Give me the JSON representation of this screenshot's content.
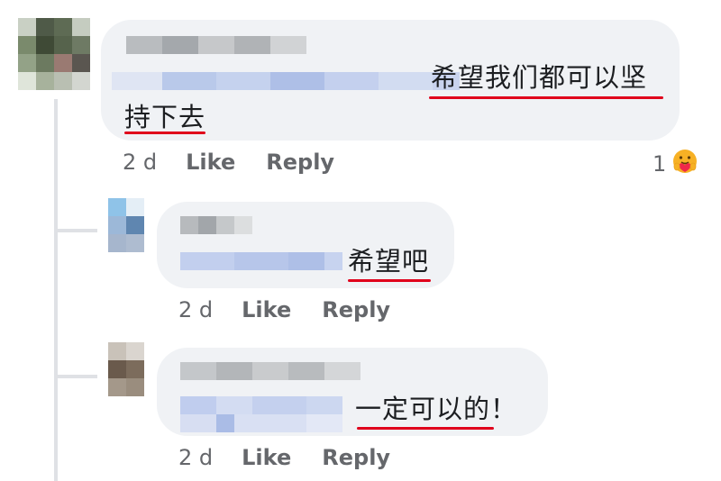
{
  "comments": [
    {
      "text_line1": "希望我们都可以坚",
      "text_line2": "持下去",
      "time": "2 d",
      "like_label": "Like",
      "reply_label": "Reply",
      "reaction_count": "1",
      "reaction_icon": "care-emoji-icon"
    },
    {
      "text": "希望吧",
      "time": "2 d",
      "like_label": "Like",
      "reply_label": "Reply"
    },
    {
      "text": "一定可以的！",
      "time": "2 d",
      "like_label": "Like",
      "reply_label": "Reply"
    }
  ],
  "colors": {
    "bubble": "#f0f2f5",
    "meta_text": "#65676b",
    "underline": "#e0001b",
    "thread_line": "#dfe1e5"
  }
}
